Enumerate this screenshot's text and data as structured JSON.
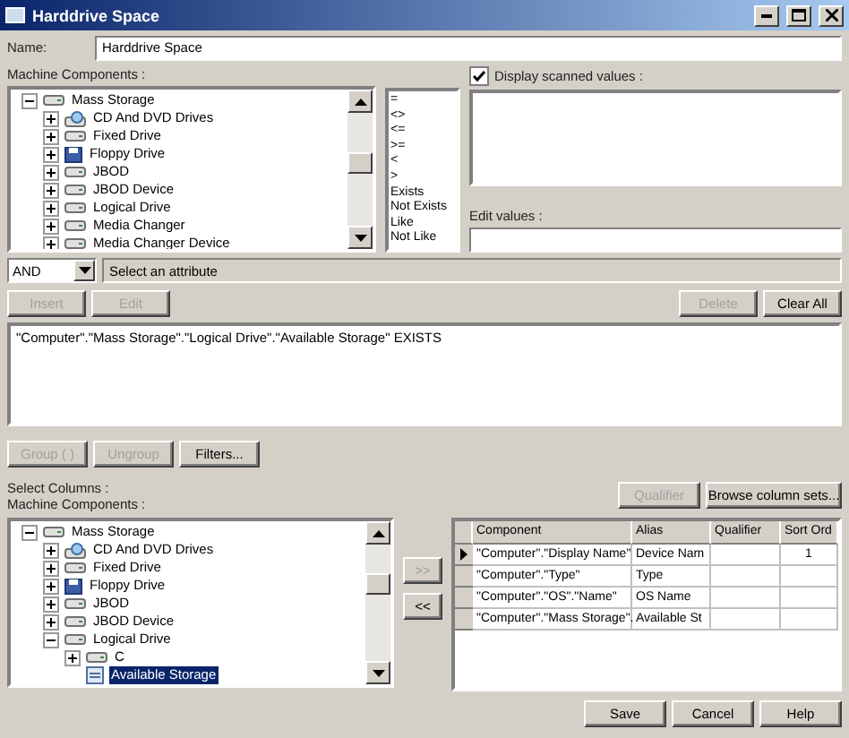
{
  "window": {
    "title": "Harddrive Space"
  },
  "name": {
    "label": "Name:",
    "value": "Harddrive Space"
  },
  "components_label": "Machine Components :",
  "tree": [
    {
      "label": "Mass Storage",
      "kind": "drive",
      "expanded": true,
      "selected": false,
      "children": [
        {
          "label": "CD And DVD Drives",
          "kind": "cd",
          "expanded": false,
          "selected": false
        },
        {
          "label": "Fixed Drive",
          "kind": "drive",
          "expanded": false,
          "selected": false
        },
        {
          "label": "Floppy Drive",
          "kind": "floppy",
          "expanded": false,
          "selected": false
        },
        {
          "label": "JBOD",
          "kind": "drive",
          "expanded": false,
          "selected": false
        },
        {
          "label": "JBOD Device",
          "kind": "drive",
          "expanded": false,
          "selected": false
        },
        {
          "label": "Logical Drive",
          "kind": "drive",
          "expanded": false,
          "selected": false
        },
        {
          "label": "Media Changer",
          "kind": "drive",
          "expanded": false,
          "selected": false
        },
        {
          "label": "Media Changer Device",
          "kind": "drive",
          "expanded": false,
          "selected": false
        }
      ]
    }
  ],
  "operators": [
    "=",
    "<>",
    "<=",
    ">=",
    "<",
    ">",
    "Exists",
    "Not Exists",
    "Like",
    "Not Like"
  ],
  "display_scanned": {
    "label": "Display scanned values :",
    "checked": true
  },
  "edit_values": {
    "label": "Edit values :"
  },
  "logic": {
    "value": "AND"
  },
  "attribute": {
    "text": "Select an attribute"
  },
  "query_buttons": [
    {
      "label": "Insert",
      "disabled": true
    },
    {
      "label": "Edit",
      "disabled": true
    }
  ],
  "list_buttons": [
    {
      "label": "Delete",
      "disabled": true
    },
    {
      "label": "Clear All",
      "disabled": false
    }
  ],
  "query": "\"Computer\".\"Mass Storage\".\"Logical Drive\".\"Available Storage\" EXISTS",
  "group_buttons": [
    {
      "label": "Group ( )",
      "disabled": true
    },
    {
      "label": "Ungroup",
      "disabled": true
    },
    {
      "label": "Filters...",
      "disabled": false
    }
  ],
  "select_columns_label": "Select Columns :",
  "components_label_2": "Machine Components :",
  "column_buttons": [
    {
      "label": "Qualifier",
      "disabled": true
    },
    {
      "label": "Browse column sets...",
      "disabled": false
    }
  ],
  "column_tree": [
    {
      "label": "Mass Storage",
      "kind": "drive",
      "expanded": true,
      "selected": false,
      "children": [
        {
          "label": "CD And DVD Drives",
          "kind": "cd",
          "expanded": false,
          "selected": false
        },
        {
          "label": "Fixed Drive",
          "kind": "drive",
          "expanded": false,
          "selected": false
        },
        {
          "label": "Floppy Drive",
          "kind": "floppy",
          "expanded": false,
          "selected": false
        },
        {
          "label": "JBOD",
          "kind": "drive",
          "expanded": false,
          "selected": false
        },
        {
          "label": "JBOD Device",
          "kind": "drive",
          "expanded": false,
          "selected": false
        },
        {
          "label": "Logical Drive",
          "kind": "drive",
          "expanded": true,
          "selected": false,
          "children": [
            {
              "label": "C",
              "kind": "drive",
              "expanded": false,
              "selected": false
            },
            {
              "label": "Available Storage",
              "kind": "attribute",
              "selected": true
            }
          ]
        }
      ]
    }
  ],
  "move_buttons": [
    {
      "label": ">>",
      "disabled": true
    },
    {
      "label": "<<",
      "disabled": false
    }
  ],
  "grid": {
    "columns": [
      "Component",
      "Alias",
      "Qualifier",
      "Sort Ord"
    ],
    "rows": [
      {
        "current": true,
        "cells": [
          "\"Computer\".\"Display Name\"",
          "Device Nam",
          "",
          "1"
        ]
      },
      {
        "current": false,
        "cells": [
          "\"Computer\".\"Type\"",
          "Type",
          "",
          ""
        ]
      },
      {
        "current": false,
        "cells": [
          "\"Computer\".\"OS\".\"Name\"",
          "OS Name",
          "",
          ""
        ]
      },
      {
        "current": false,
        "cells": [
          "\"Computer\".\"Mass Storage\".",
          "Available St",
          "",
          ""
        ]
      }
    ]
  },
  "footer_buttons": [
    "Save",
    "Cancel",
    "Help"
  ]
}
